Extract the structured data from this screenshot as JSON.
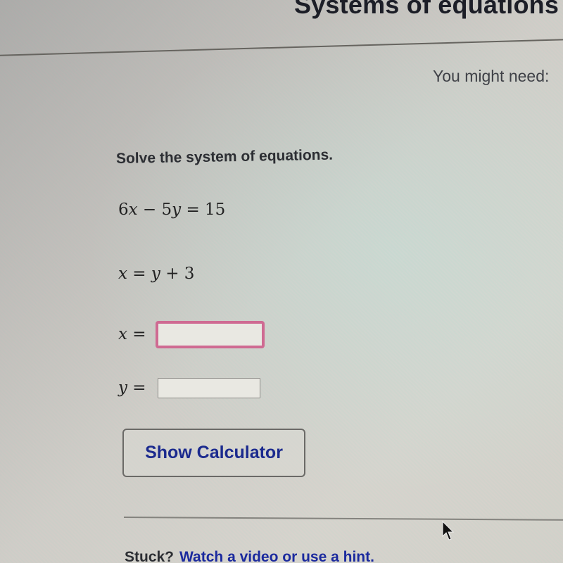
{
  "header": {
    "title": "Systems of equations",
    "might_need_label": "You might need:"
  },
  "question": {
    "prompt": "Solve the system of equations.",
    "equations": [
      {
        "parts": [
          "6",
          "x",
          " − 5",
          "y",
          " = 15"
        ]
      },
      {
        "parts": [
          "x",
          " = ",
          "y",
          " + 3"
        ]
      }
    ]
  },
  "answers": {
    "x": {
      "var": "x",
      "equals": " =",
      "value": "",
      "placeholder": "",
      "focused": true
    },
    "y": {
      "var": "y",
      "equals": " =",
      "value": "",
      "placeholder": ""
    }
  },
  "calculator_button": {
    "label": "Show Calculator"
  },
  "footer": {
    "stuck_label": "Stuck?",
    "hint_link": "Watch a video or use a hint."
  },
  "colors": {
    "focus_border": "#cf6a92",
    "link_blue": "#1b2a9e",
    "button_text": "#1b2a8e"
  }
}
